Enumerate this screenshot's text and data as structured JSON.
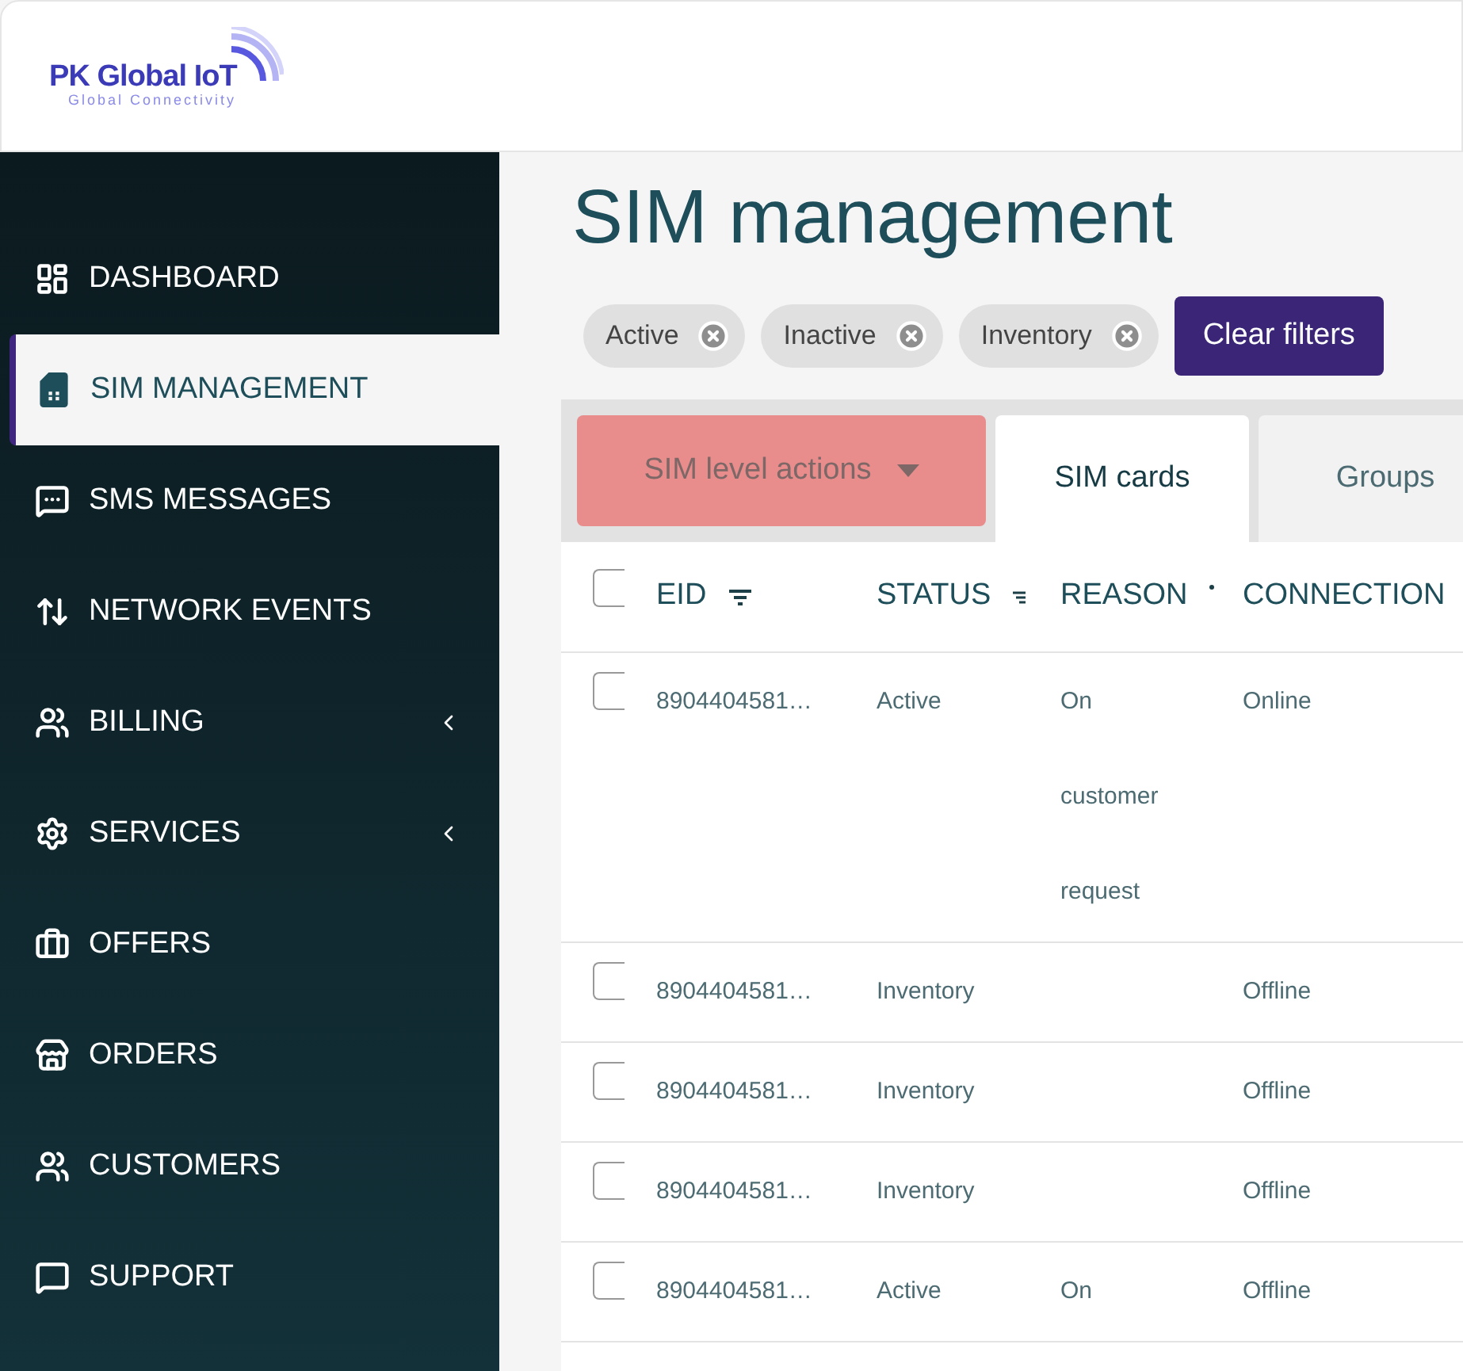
{
  "logo": {
    "name": "PK Global IoT",
    "tagline": "Global Connectivity"
  },
  "sidebar": {
    "items": [
      {
        "label": "DASHBOARD",
        "selected": false,
        "has_submenu": false
      },
      {
        "label": "SIM MANAGEMENT",
        "selected": true,
        "has_submenu": false
      },
      {
        "label": "SMS MESSAGES",
        "selected": false,
        "has_submenu": false
      },
      {
        "label": "NETWORK EVENTS",
        "selected": false,
        "has_submenu": false
      },
      {
        "label": "BILLING",
        "selected": false,
        "has_submenu": true
      },
      {
        "label": "SERVICES",
        "selected": false,
        "has_submenu": true
      },
      {
        "label": "OFFERS",
        "selected": false,
        "has_submenu": false
      },
      {
        "label": "ORDERS",
        "selected": false,
        "has_submenu": false
      },
      {
        "label": "CUSTOMERS",
        "selected": false,
        "has_submenu": false
      },
      {
        "label": "SUPPORT",
        "selected": false,
        "has_submenu": false
      }
    ]
  },
  "page_title": "SIM management",
  "filters": [
    {
      "label": "Active"
    },
    {
      "label": "Inactive"
    },
    {
      "label": "Inventory"
    }
  ],
  "clear_filters": "Clear filters",
  "actions_button": {
    "label": "SIM level actions",
    "disabled": true
  },
  "tabs": [
    {
      "label": "SIM cards",
      "selected": true
    },
    {
      "label": "Groups",
      "selected": false
    }
  ],
  "table": {
    "select_all_checked": false,
    "columns": [
      {
        "label": "EID",
        "kind": "filter"
      },
      {
        "label": "STATUS",
        "kind": "small-filter"
      },
      {
        "label": "REASON",
        "kind": "dot"
      },
      {
        "label": "CONNECTION",
        "kind": "plain"
      }
    ],
    "rows": [
      {
        "checked": false,
        "cells": [
          "8904404581…",
          "Active",
          "On customer request",
          "Online"
        ]
      },
      {
        "checked": false,
        "cells": [
          "8904404581…",
          "Inventory",
          "",
          "Offline"
        ]
      },
      {
        "checked": false,
        "cells": [
          "8904404581…",
          "Inventory",
          "",
          "Offline"
        ]
      },
      {
        "checked": false,
        "cells": [
          "8904404581…",
          "Inventory",
          "",
          "Offline"
        ]
      },
      {
        "checked": false,
        "cells": [
          "8904404581…",
          "Active",
          "On",
          "Offline"
        ]
      }
    ]
  }
}
